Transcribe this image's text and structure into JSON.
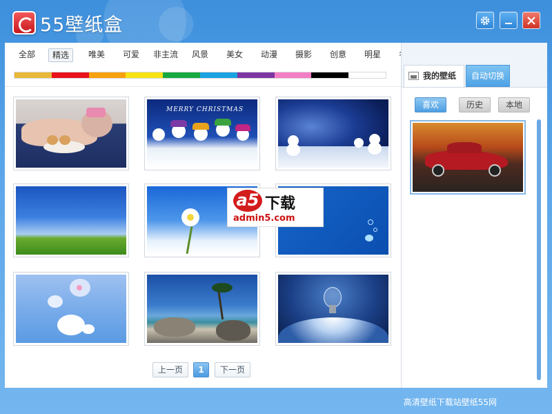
{
  "app": {
    "title": "55壁纸盒",
    "logo_icon": "55-logo-icon"
  },
  "window_controls": {
    "settings_icon": "gear-icon",
    "minimize_icon": "minimize-icon",
    "close_icon": "close-icon"
  },
  "categories": [
    "全部",
    "精选",
    "唯美",
    "可爱",
    "非主流",
    "风景",
    "美女",
    "动漫",
    "摄影",
    "创意",
    "明星",
    "名车"
  ],
  "active_category": "精选",
  "color_filters": [
    "#e8b83a",
    "#e8121b",
    "#f7a10e",
    "#f7e314",
    "#17a840",
    "#1aa3e2",
    "#7b36a2",
    "#f37ec5",
    "#000000",
    "#ffffff"
  ],
  "thumbnails": [
    {
      "alt": "sleeping-puppy"
    },
    {
      "alt": "merry-christmas-snowmen",
      "caption": "MERRY CHRISTMAS"
    },
    {
      "alt": "snowmen-night"
    },
    {
      "alt": "blue-sky-grassland"
    },
    {
      "alt": "daisy-sky"
    },
    {
      "alt": "blue-bubbles"
    },
    {
      "alt": "blue-flowers"
    },
    {
      "alt": "tropical-beach"
    },
    {
      "alt": "lightbulb-earth"
    }
  ],
  "watermark": {
    "brand": "a5",
    "text": "下载",
    "url": "admin5.com"
  },
  "pagination": {
    "prev": "上一页",
    "current": "1",
    "next": "下一页"
  },
  "sidebar": {
    "tabs": [
      "我的壁纸",
      "自动切换"
    ],
    "active_tab": "我的壁纸",
    "subtabs": [
      "喜欢",
      "历史",
      "本地"
    ],
    "active_subtab": "喜欢",
    "selected_item": "red-classic-car"
  },
  "status": {
    "text": "高清壁纸下载站壁纸55网"
  }
}
